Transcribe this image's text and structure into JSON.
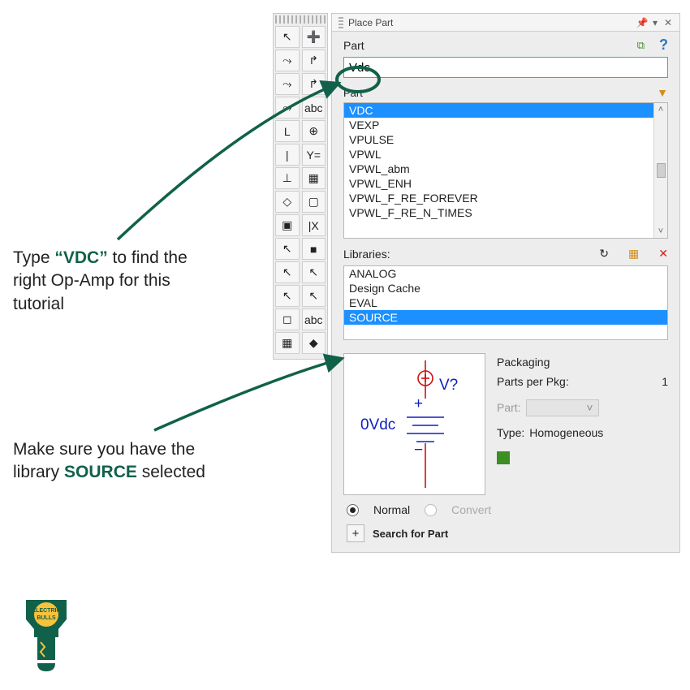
{
  "annotations": {
    "a1_pre": "Type ",
    "a1_hl": "“VDC”",
    "a1_post": " to find the right Op-Amp for this tutorial",
    "a2_pre": "Make sure you have the library ",
    "a2_hl": "SOURCE",
    "a2_post": " selected"
  },
  "panel": {
    "title": "Place Part",
    "part_label": "Part",
    "search_value": "Vdc",
    "list_label": "Part",
    "parts": [
      "VDC",
      "VEXP",
      "VPULSE",
      "VPWL",
      "VPWL_abm",
      "VPWL_ENH",
      "VPWL_F_RE_FOREVER",
      "VPWL_F_RE_N_TIMES"
    ],
    "selected_part_index": 0,
    "libraries_label": "Libraries:",
    "libraries": [
      "ANALOG",
      "Design Cache",
      "EVAL",
      "SOURCE"
    ],
    "selected_library_index": 3,
    "packaging": {
      "title": "Packaging",
      "ppp_label": "Parts per Pkg:",
      "ppp_value": "1",
      "part_label": "Part:",
      "type_label": "Type:",
      "type_value": "Homogeneous"
    },
    "preview": {
      "value_text": "0Vdc",
      "refdes": "V?"
    },
    "radios": {
      "normal": "Normal",
      "convert": "Convert"
    },
    "search_part": "Search for Part",
    "plus": "+"
  },
  "tool_icons": [
    [
      "↖",
      "➕"
    ],
    [
      "⤳",
      "↱"
    ],
    [
      "⤳",
      "↱"
    ],
    [
      "⤳",
      "abc"
    ],
    [
      "L",
      "⊕"
    ],
    [
      "|",
      "Y="
    ],
    [
      "⊥",
      "▦"
    ],
    [
      "◇",
      "▢"
    ],
    [
      "▣",
      "|X"
    ],
    [
      "↖",
      "■"
    ],
    [
      "↖",
      "↖"
    ],
    [
      "↖",
      "↖"
    ],
    [
      "◻",
      "abc"
    ],
    [
      "▦",
      "◆"
    ]
  ],
  "logo": {
    "top": "ELECTRIC",
    "bottom": "BULLS"
  }
}
